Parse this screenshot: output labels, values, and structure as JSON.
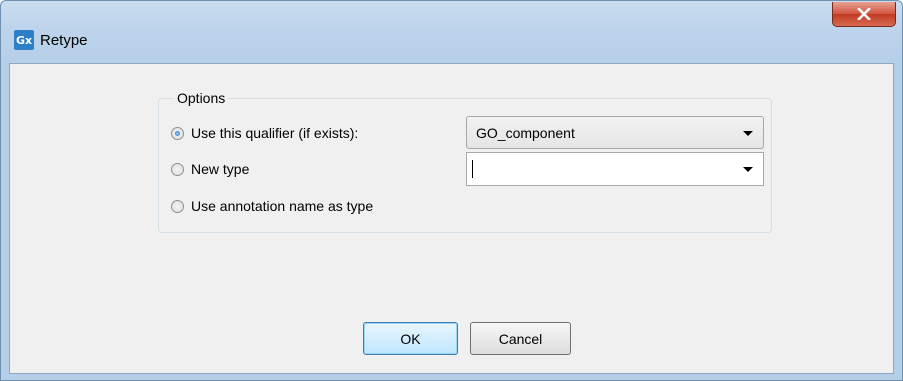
{
  "window": {
    "app_icon_text": "Gx",
    "title": "Retype",
    "close_icon": "close-x-icon"
  },
  "options": {
    "legend": "Options",
    "radios": [
      {
        "label": "Use this qualifier (if exists):",
        "checked": true
      },
      {
        "label": "New type",
        "checked": false
      },
      {
        "label": "Use annotation name as type",
        "checked": false
      }
    ],
    "qualifier_select": {
      "value": "GO_component"
    },
    "new_type_combo": {
      "value": ""
    }
  },
  "buttons": {
    "ok": "OK",
    "cancel": "Cancel"
  },
  "colors": {
    "title_bar": "#bcd3eb",
    "client_bg": "#f0f0f0",
    "close_button": "#c8452c",
    "default_button_border": "#3c7fb1"
  }
}
